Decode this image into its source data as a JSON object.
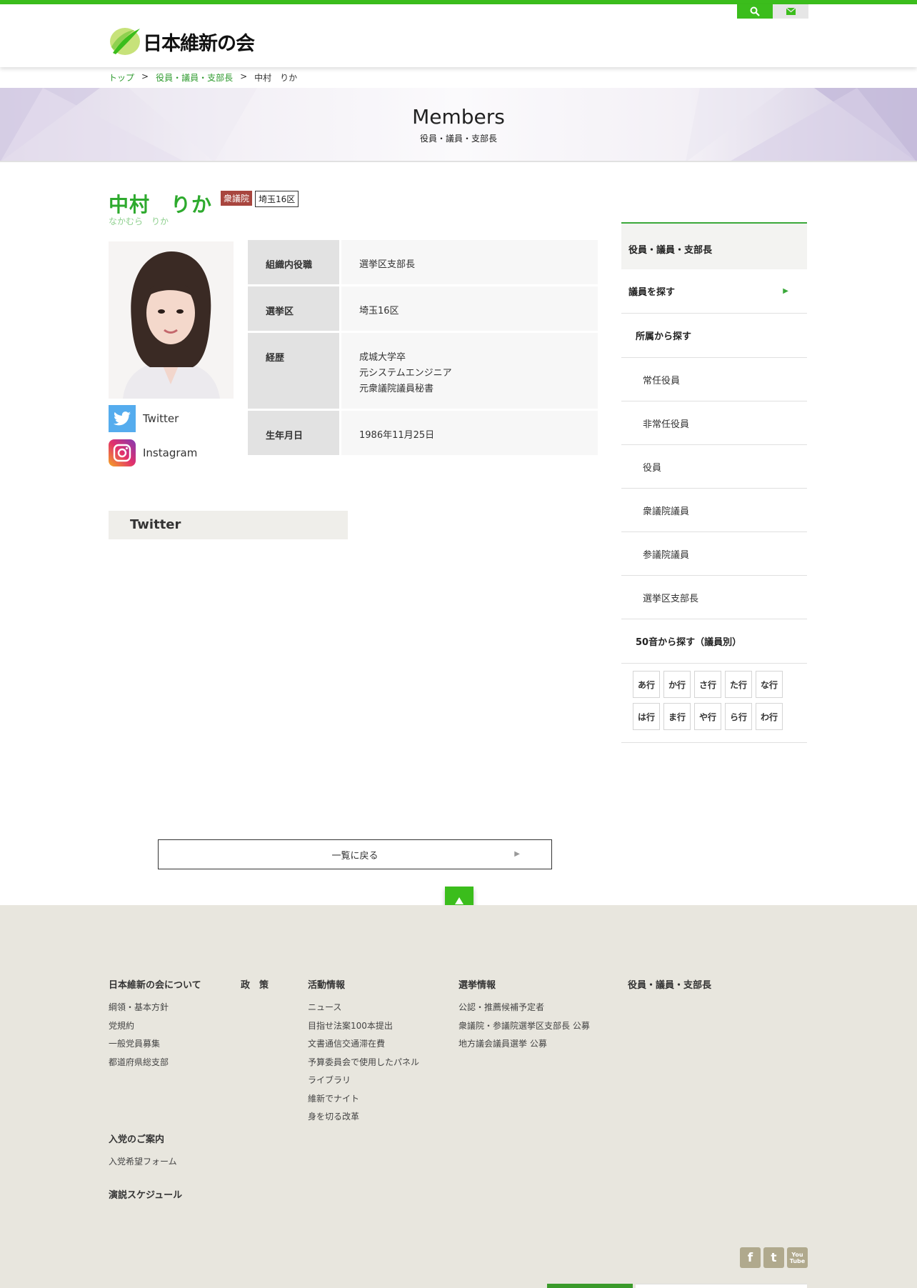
{
  "site": {
    "logo_text": "日本維新の会"
  },
  "header": {
    "search_icon": "search-icon",
    "mail_icon": "mail-icon"
  },
  "breadcrumb": {
    "home": "トップ",
    "sep": ">",
    "section": "役員・議員・支部長",
    "current": "中村　りか"
  },
  "banner": {
    "title": "Members",
    "subtitle": "役員・議員・支部長"
  },
  "member": {
    "name": "中村　りか",
    "kana": "なかむら　りか",
    "house_badge": "衆議院",
    "district_badge": "埼玉16区",
    "social": [
      {
        "label": "Twitter",
        "icon": "twitter-icon"
      },
      {
        "label": "Instagram",
        "icon": "instagram-icon"
      }
    ],
    "info": [
      {
        "key": "組織内役職",
        "value": "選挙区支部長"
      },
      {
        "key": "選挙区",
        "value": "埼玉16区"
      },
      {
        "key": "経歴",
        "value": "成城大学卒\n元システムエンジニア\n元衆議院議員秘書"
      },
      {
        "key": "生年月日",
        "value": "1986年11月25日"
      }
    ]
  },
  "twitter_section": {
    "title": "Twitter"
  },
  "back_button": {
    "label": "一覧に戻る",
    "arrow": "▶"
  },
  "to_top": {
    "arrow": "▲"
  },
  "sidebar": {
    "title": "役員・議員・支部長",
    "search": "議員を探す",
    "search_arrow": "▶",
    "by_affiliation": "所属から探す",
    "affiliations": [
      "常任役員",
      "非常任役員",
      "役員",
      "衆議院議員",
      "参議院議員",
      "選挙区支部長"
    ],
    "by_kana": "50音から探す（議員別）",
    "kana": [
      "あ行",
      "か行",
      "さ行",
      "た行",
      "な行",
      "は行",
      "ま行",
      "や行",
      "ら行",
      "わ行"
    ]
  },
  "footer": {
    "about": {
      "title": "日本維新の会について",
      "links": [
        "綱領・基本方針",
        "党規約",
        "一般党員募集",
        "都道府県総支部"
      ]
    },
    "policy": {
      "title": "政　策"
    },
    "activity": {
      "title": "活動情報",
      "links": [
        "ニュース",
        "目指せ法案100本提出",
        "文書通信交通滞在費",
        "予算委員会で使用したパネル",
        "ライブラリ",
        "維新でナイト",
        "身を切る改革"
      ]
    },
    "election": {
      "title": "選挙情報",
      "links": [
        "公認・推薦候補予定者",
        "衆議院・参議院選挙区支部長 公募",
        "地方議会議員選挙 公募"
      ]
    },
    "members": {
      "title": "役員・議員・支部長"
    },
    "join": {
      "title": "入党のご案内",
      "links": [
        "入党希望フォーム"
      ]
    },
    "speech": {
      "title": "演説スケジュール"
    },
    "sns": [
      {
        "icon": "facebook-icon",
        "glyph": "f"
      },
      {
        "icon": "twitter-icon",
        "glyph": "t"
      },
      {
        "icon": "youtube-icon",
        "glyph": "You Tube"
      }
    ]
  }
}
